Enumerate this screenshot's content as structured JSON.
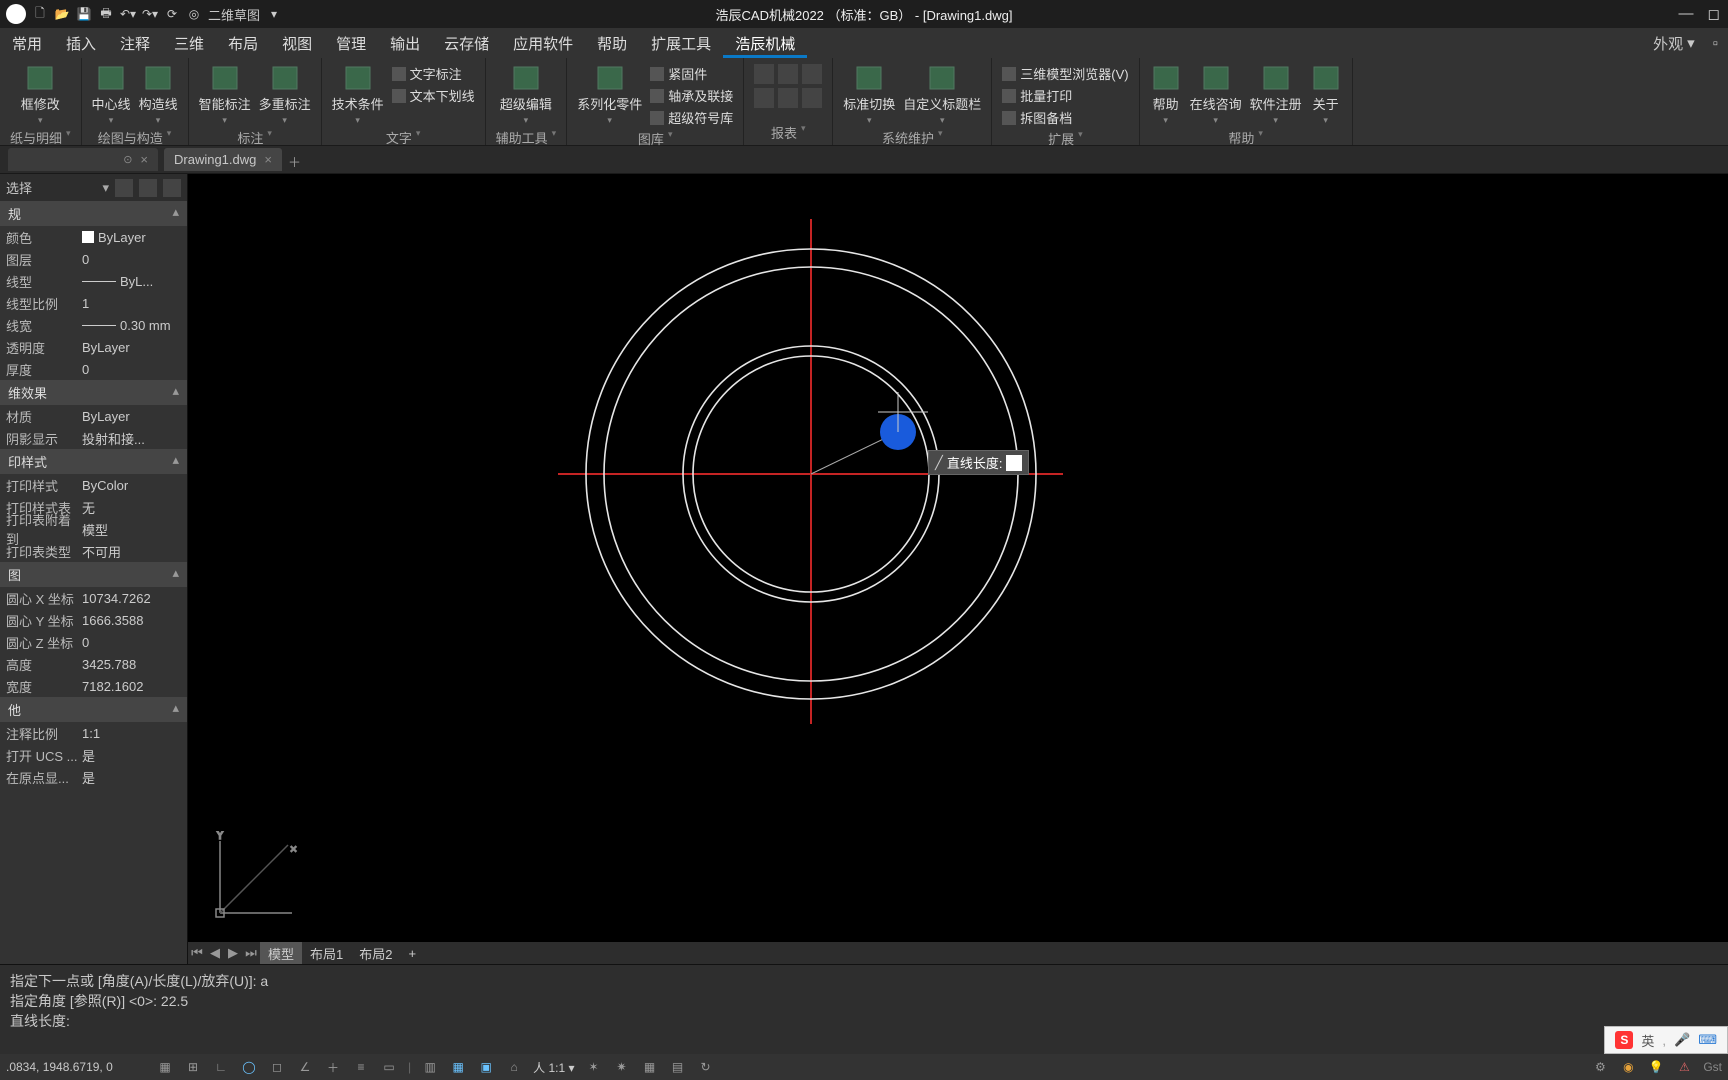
{
  "titlebar": {
    "app_title": "浩辰CAD机械2022 （标准：GB） - [Drawing1.dwg]",
    "qat_label": "二维草图"
  },
  "menutabs": {
    "items": [
      "常用",
      "插入",
      "注释",
      "三维",
      "布局",
      "视图",
      "管理",
      "输出",
      "云存储",
      "应用软件",
      "帮助",
      "扩展工具",
      "浩辰机械"
    ],
    "right_label": "外观",
    "active_index": 12
  },
  "ribbon": {
    "panels": [
      {
        "title": "纸与明细",
        "big": [
          {
            "label": "框修改"
          }
        ]
      },
      {
        "title": "绘图与构造",
        "big": [
          {
            "label": "中心线"
          },
          {
            "label": "构造线"
          }
        ]
      },
      {
        "title": "标注",
        "big": [
          {
            "label": "智能标注"
          },
          {
            "label": "多重标注"
          }
        ]
      },
      {
        "title": "文字",
        "big": [
          {
            "label": "技术条件"
          }
        ],
        "rows": [
          "文字标注",
          "文本下划线"
        ]
      },
      {
        "title": "辅助工具",
        "big": [
          {
            "label": "超级编辑"
          }
        ]
      },
      {
        "title": "图库",
        "big": [
          {
            "label": "系列化零件"
          }
        ],
        "rows": [
          "紧固件",
          "轴承及联接",
          "超级符号库"
        ]
      },
      {
        "title": "报表",
        "big": []
      },
      {
        "title": "系统维护",
        "big": [
          {
            "label": "标准切换"
          },
          {
            "label": "自定义标题栏"
          }
        ]
      },
      {
        "title": "扩展",
        "rows": [
          "三维模型浏览器(V)",
          "批量打印",
          "拆图备档"
        ]
      },
      {
        "title": "帮助",
        "big": [
          {
            "label": "帮助"
          },
          {
            "label": "在线咨询"
          },
          {
            "label": "软件注册"
          },
          {
            "label": "关于"
          }
        ]
      }
    ]
  },
  "file_tabs": {
    "blank_tab": "",
    "tabs": [
      {
        "label": "Drawing1.dwg",
        "active": true
      }
    ]
  },
  "palette": {
    "select_label": "选择",
    "sections": [
      {
        "title": "规",
        "rows": [
          {
            "k": "颜色",
            "v": "ByLayer",
            "swatch": "#ffffff"
          },
          {
            "k": "图层",
            "v": "0"
          },
          {
            "k": "线型",
            "v": "ByL...",
            "line": true
          },
          {
            "k": "线型比例",
            "v": "1"
          },
          {
            "k": "线宽",
            "v": "0.30 mm",
            "line": true
          },
          {
            "k": "透明度",
            "v": "ByLayer"
          },
          {
            "k": "厚度",
            "v": "0"
          }
        ]
      },
      {
        "title": "维效果",
        "rows": [
          {
            "k": "材质",
            "v": "ByLayer"
          },
          {
            "k": "阴影显示",
            "v": "投射和接..."
          }
        ]
      },
      {
        "title": "印样式",
        "rows": [
          {
            "k": "打印样式",
            "v": "ByColor"
          },
          {
            "k": "打印样式表",
            "v": "无"
          },
          {
            "k": "打印表附着到",
            "v": "模型"
          },
          {
            "k": "打印表类型",
            "v": "不可用"
          }
        ]
      },
      {
        "title": "图",
        "rows": [
          {
            "k": "圆心 X 坐标",
            "v": "10734.7262"
          },
          {
            "k": "圆心 Y 坐标",
            "v": "1666.3588"
          },
          {
            "k": "圆心 Z 坐标",
            "v": "0"
          },
          {
            "k": "高度",
            "v": "3425.788"
          },
          {
            "k": "宽度",
            "v": "7182.1602"
          }
        ]
      },
      {
        "title": "他",
        "rows": [
          {
            "k": "注释比例",
            "v": "1:1"
          },
          {
            "k": "打开 UCS ...",
            "v": "是"
          },
          {
            "k": "在原点显...",
            "v": "是"
          }
        ]
      }
    ]
  },
  "canvas": {
    "tooltip_label": "直线长度:",
    "layout_tabs": [
      "模型",
      "布局1",
      "布局2"
    ],
    "layout_plus": "+"
  },
  "commandline": {
    "lines": [
      "指定下一点或 [角度(A)/长度(L)/放弃(U)]: a",
      "指定角度 [参照(R)] <0>:  22.5",
      "直线长度:"
    ]
  },
  "statusbar": {
    "coords": ".0834, 1948.6719, 0",
    "scale_label": "人 1:1 ▾",
    "ime_lang": "英",
    "ime_right": "Gst",
    "sogou": "S"
  }
}
